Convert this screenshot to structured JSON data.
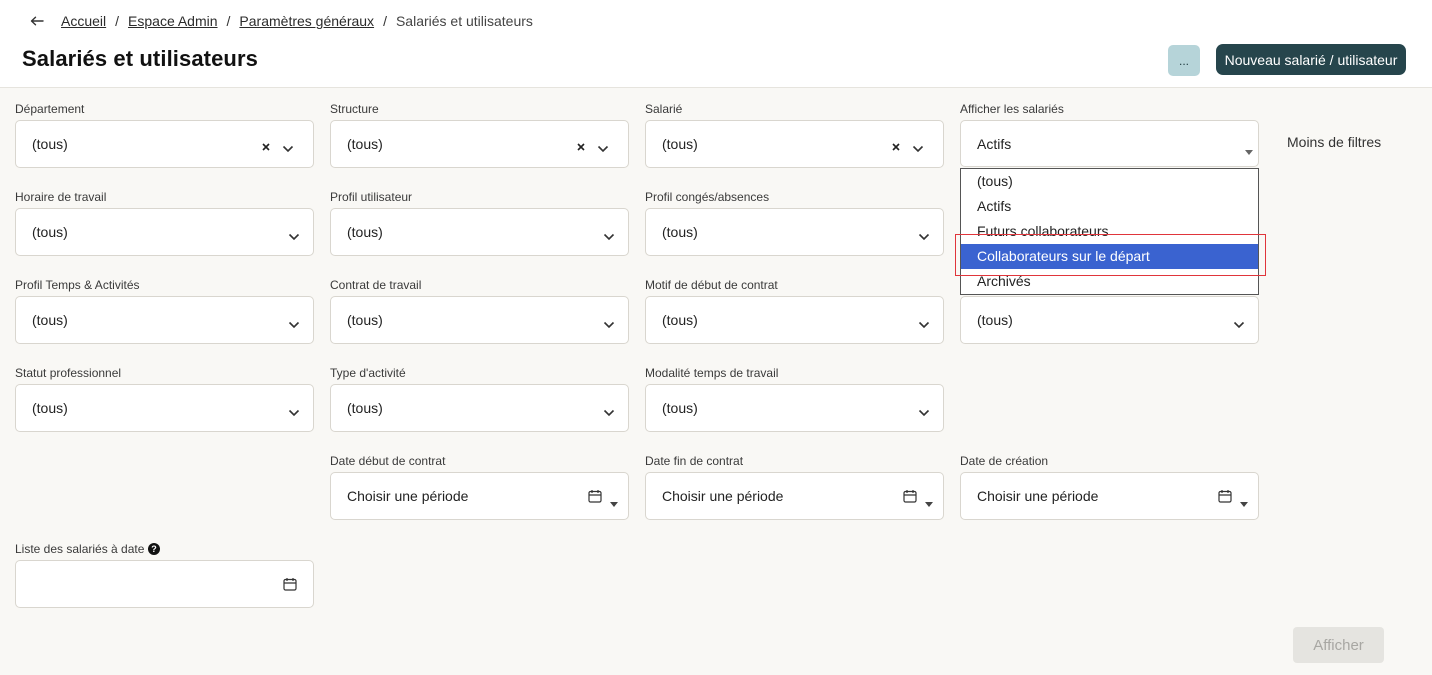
{
  "breadcrumb": {
    "items": [
      "Accueil",
      "Espace Admin",
      "Paramètres généraux"
    ],
    "current": "Salariés et utilisateurs",
    "separator": "/"
  },
  "header": {
    "title": "Salariés et utilisateurs",
    "more_label": "...",
    "new_label": "Nouveau salarié / utilisateur"
  },
  "filters": {
    "departement": {
      "label": "Département",
      "value": "(tous)"
    },
    "structure": {
      "label": "Structure",
      "value": "(tous)"
    },
    "salarie": {
      "label": "Salarié",
      "value": "(tous)"
    },
    "afficher": {
      "label": "Afficher les salariés",
      "value": "Actifs"
    },
    "horaire": {
      "label": "Horaire de travail",
      "value": "(tous)"
    },
    "profil_utilisateur": {
      "label": "Profil utilisateur",
      "value": "(tous)"
    },
    "profil_conges": {
      "label": "Profil congés/absences",
      "value": "(tous)"
    },
    "profil_temps": {
      "label": "Profil Temps & Activités",
      "value": "(tous)"
    },
    "contrat": {
      "label": "Contrat de travail",
      "value": "(tous)"
    },
    "motif": {
      "label": "Motif de début de contrat",
      "value": "(tous)"
    },
    "hidden_col4": {
      "value": "(tous)"
    },
    "statut": {
      "label": "Statut professionnel",
      "value": "(tous)"
    },
    "type_activite": {
      "label": "Type d'activité",
      "value": "(tous)"
    },
    "modalite": {
      "label": "Modalité temps de travail",
      "value": "(tous)"
    },
    "date_debut": {
      "label": "Date début de contrat",
      "value": "Choisir une période"
    },
    "date_fin": {
      "label": "Date fin de contrat",
      "value": "Choisir une période"
    },
    "date_creation": {
      "label": "Date de création",
      "value": "Choisir une période"
    },
    "liste_date": {
      "label": "Liste des salariés à date",
      "value": ""
    }
  },
  "dropdown": {
    "options": [
      "(tous)",
      "Actifs",
      "Futurs collaborateurs",
      "Collaborateurs sur le départ",
      "Archivés"
    ],
    "selected_index": 3
  },
  "less_filters_label": "Moins de filtres",
  "afficher_button": "Afficher",
  "colors": {
    "primary": "#26454c",
    "secondary": "#b6d4d9",
    "selection": "#3a63d0",
    "highlight": "#e0353b"
  }
}
